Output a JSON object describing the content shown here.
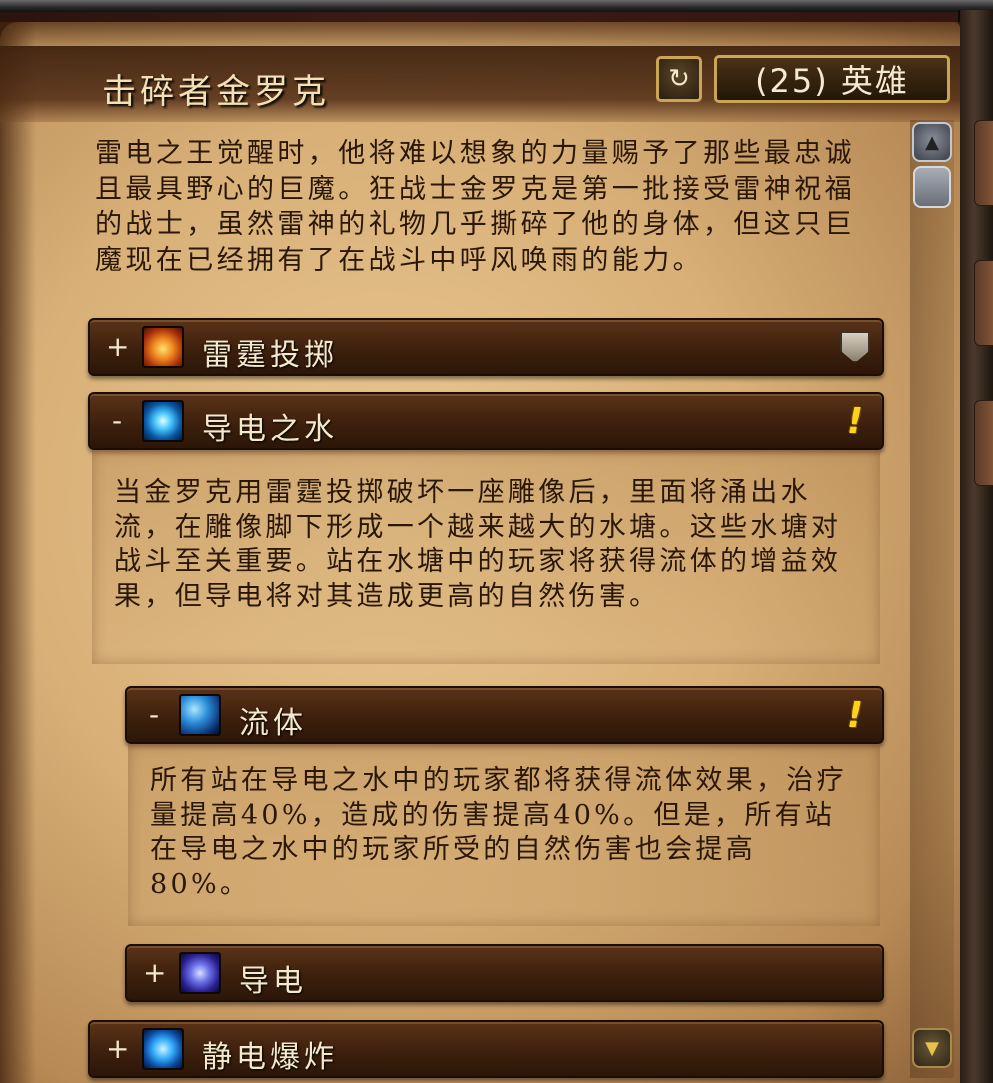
{
  "header": {
    "boss_name": "击碎者金罗克",
    "refresh_icon": "↻",
    "difficulty": "(25) 英雄"
  },
  "intro": "雷电之王觉醒时，他将难以想象的力量赐予了那些最忠诚且最具野心的巨魔。狂战士金罗克是第一批接受雷神祝福的战士，虽然雷神的礼物几乎撕碎了他的身体，但这只巨魔现在已经拥有了在战斗中呼风唤雨的能力。",
  "sections": [
    {
      "toggle": "+",
      "icon": "thundering-throw-icon",
      "label": "雷霆投掷",
      "flag": "shield-icon",
      "expanded": false
    },
    {
      "toggle": "-",
      "icon": "conductive-water-icon",
      "label": "导电之水",
      "flag": "!",
      "expanded": true,
      "description": "当金罗克用雷霆投掷破坏一座雕像后，里面将涌出水流，在雕像脚下形成一个越来越大的水塘。这些水塘对战斗至关重要。站在水塘中的玩家将获得流体的增益效果，但导电将对其造成更高的自然伤害。",
      "children": [
        {
          "toggle": "-",
          "icon": "fluidity-icon",
          "label": "流体",
          "flag": "!",
          "expanded": true,
          "description": "所有站在导电之水中的玩家都将获得流体效果，治疗量提高40%，造成的伤害提高40%。但是，所有站在导电之水中的玩家所受的自然伤害也会提高80%。"
        },
        {
          "toggle": "+",
          "icon": "electrified-waters-icon",
          "label": "导电",
          "expanded": false
        }
      ]
    },
    {
      "toggle": "+",
      "icon": "static-burst-icon",
      "label": "静电爆炸",
      "expanded": false
    }
  ],
  "scrollbar": {
    "up_icon": "scroll-up-icon",
    "down_icon": "scroll-down-icon"
  }
}
